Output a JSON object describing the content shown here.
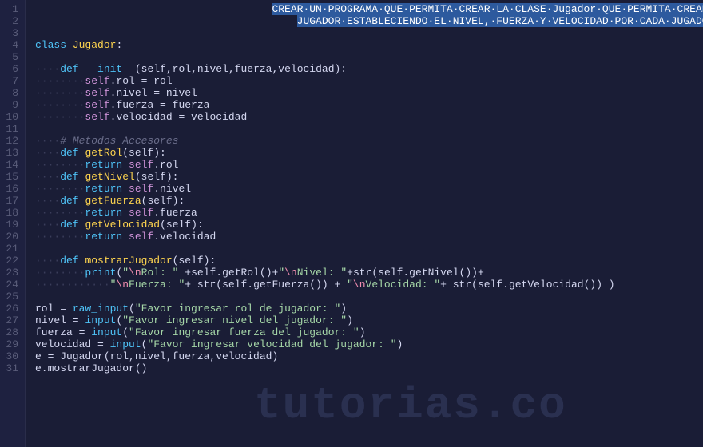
{
  "watermark": "tutorias.co",
  "colors": {
    "background": "#1a1d36",
    "gutter": "#1e2140",
    "selection": "#2d5a9e",
    "keyword": "#4fc3f7",
    "class": "#ffd54f",
    "string": "#a5d6a7",
    "comment": "#6a6d8a"
  },
  "lines": {
    "1": {
      "indent": 38,
      "comment_sel": "CREAR·UN·PROGRAMA·QUE·PERMITA·CREAR·LA·CLASE·Jugador·QUE·PERMITA·CREAR·VARIOS·ROL·DE"
    },
    "2": {
      "indent": 42,
      "comment_sel": "JUGADOR·ESTABLECIENDO·EL·NIVEL,·FUERZA·Y·VELOCIDAD·POR·CADA·JUGADOR·CREADO"
    },
    "3": {
      "blank": true
    },
    "4": {
      "kw": "class",
      "cls": "Jugador",
      "colon": ":"
    },
    "5": {
      "blank": true
    },
    "6": {
      "indent": 1,
      "kw": "def",
      "sp": "__init__",
      "params": "(self,rol,nivel,fuerza,velocidad):"
    },
    "7": {
      "indent": 2,
      "self": "self",
      "op1": ".rol = rol"
    },
    "8": {
      "indent": 2,
      "self": "self",
      "op1": ".nivel = nivel"
    },
    "9": {
      "indent": 2,
      "self": "self",
      "op1": ".fuerza = fuerza"
    },
    "10": {
      "indent": 2,
      "self": "self",
      "op1": ".velocidad = velocidad"
    },
    "11": {
      "blank": true
    },
    "12": {
      "indent": 1,
      "cmt": "# Metodos Accesores"
    },
    "13": {
      "indent": 1,
      "kw": "def",
      "meth": "getRol",
      "params": "(self):"
    },
    "14": {
      "indent": 2,
      "kw": "return",
      "self": " self",
      "rest": ".rol"
    },
    "15": {
      "indent": 1,
      "kw": "def",
      "meth": "getNivel",
      "params": "(self):"
    },
    "16": {
      "indent": 2,
      "kw": "return",
      "self": " self",
      "rest": ".nivel"
    },
    "17": {
      "indent": 1,
      "kw": "def",
      "meth": "getFuerza",
      "params": "(self):"
    },
    "18": {
      "indent": 2,
      "kw": "return",
      "self": " self",
      "rest": ".fuerza"
    },
    "19": {
      "indent": 1,
      "kw": "def",
      "meth": "getVelocidad",
      "params": "(self):"
    },
    "20": {
      "indent": 2,
      "kw": "return",
      "self": " self",
      "rest": ".velocidad"
    },
    "21": {
      "blank": true
    },
    "22": {
      "indent": 1,
      "kw": "def",
      "meth": "mostrarJugador",
      "params": "(self):"
    },
    "23": {
      "indent": 2,
      "call": "print",
      "s1": "\"",
      "e1": "\\n",
      "s2": "Rol: \"",
      "plus1": " +self.getRol()+",
      "s3": "\"",
      "e2": "\\n",
      "s4": "Nivel: \"",
      "plus2": "+str(self.getNivel())+"
    },
    "24": {
      "indent": 3,
      "s1": "\"",
      "e1": "\\n",
      "s2": "Fuerza: \"",
      "plus1": "+ str(self.getFuerza()) + ",
      "s3": "\"",
      "e2": "\\n",
      "s4": "Velocidad: \"",
      "plus2": "+ str(self.getVelocidad()) )"
    },
    "25": {
      "blank": true
    },
    "26": {
      "var": "rol = ",
      "call": "raw_input",
      "p": "(",
      "str": "\"Favor ingresar rol de jugador: \"",
      "p2": ")"
    },
    "27": {
      "var": "nivel = ",
      "call": "input",
      "p": "(",
      "str": "\"Favor ingresar nivel del jugador: \"",
      "p2": ")"
    },
    "28": {
      "var": "fuerza = ",
      "call": "input",
      "p": "(",
      "str": "\"Favor ingresar fuerza del jugador: \"",
      "p2": ")"
    },
    "29": {
      "var": "velocidad = ",
      "call": "input",
      "p": "(",
      "str": "\"Favor ingresar velocidad del jugador: \"",
      "p2": ")"
    },
    "30": {
      "rest": "e = Jugador(rol,nivel,fuerza,velocidad)"
    },
    "31": {
      "rest": "e.mostrarJugador()"
    }
  },
  "line_count": 31
}
